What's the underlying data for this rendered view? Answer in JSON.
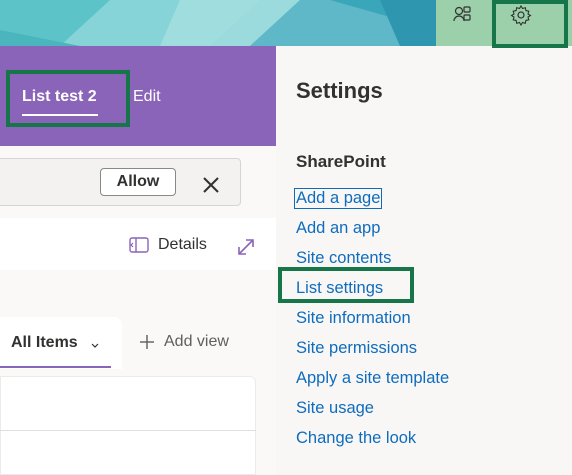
{
  "banner": {
    "icons": [
      {
        "name": "share-icon"
      },
      {
        "name": "gear-icon"
      }
    ]
  },
  "page": {
    "list_title": "List test 2",
    "edit_label": "Edit",
    "allow_button": "Allow",
    "details_label": "Details",
    "tabs": [
      {
        "label": "All Items",
        "selected": true
      },
      {
        "label": "Add view",
        "selected": false
      }
    ]
  },
  "settings_panel": {
    "title": "Settings",
    "section": "SharePoint",
    "links": [
      {
        "label": "Add a page"
      },
      {
        "label": "Add an app"
      },
      {
        "label": "Site contents"
      },
      {
        "label": "List settings"
      },
      {
        "label": "Site information"
      },
      {
        "label": "Site permissions"
      },
      {
        "label": "Apply a site template"
      },
      {
        "label": "Site usage"
      },
      {
        "label": "Change the look"
      }
    ]
  },
  "colors": {
    "accent_purple": "#8a64b8",
    "link_blue": "#0f6cbd",
    "highlight_green": "#17754a"
  }
}
